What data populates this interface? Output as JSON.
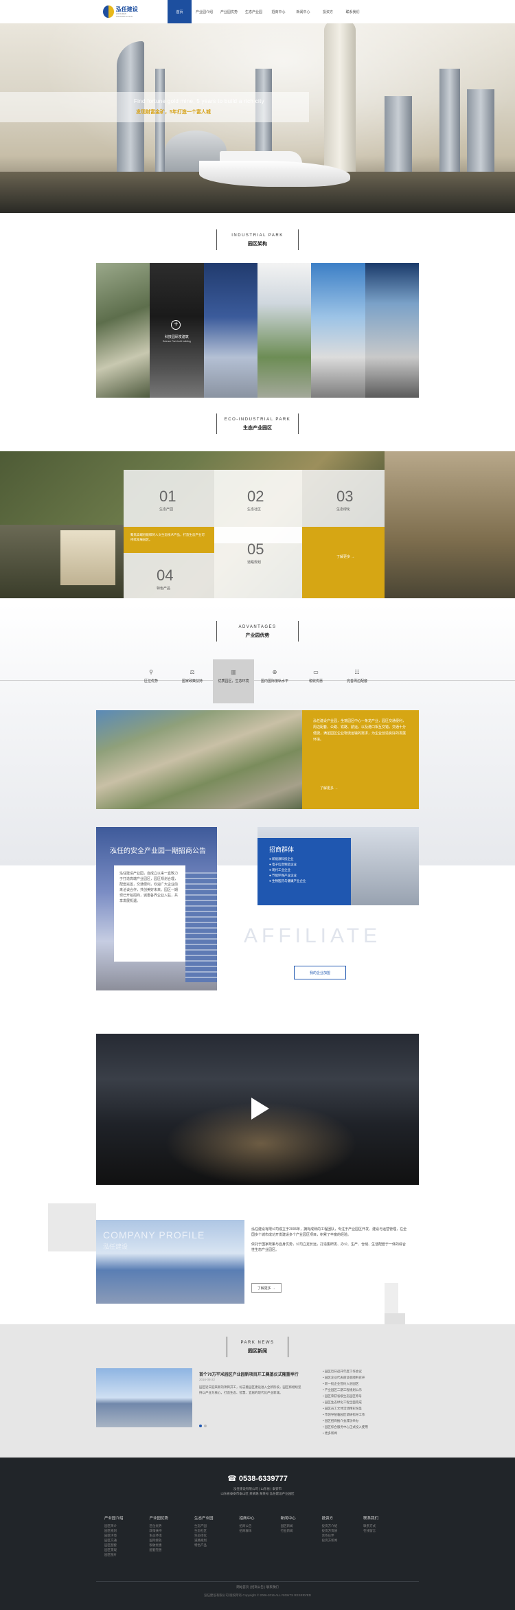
{
  "header": {
    "logo_text": "泓任建设",
    "logo_sub": "HONGREN CONSTRUCTION",
    "nav": [
      "首页",
      "产业园介绍",
      "产业园优势",
      "生态产业园",
      "招商中心",
      "新闻中心",
      "投资方",
      "联系我们"
    ]
  },
  "hero": {
    "en": "Find fortune gold mine, 5 years to build a rich city",
    "cn": "发现财富金矿，5年打造一个富人城"
  },
  "industrial": {
    "en": "INDUSTRIAL PARK",
    "cn": "园区架构",
    "feature_title": "科技园研发建筑",
    "feature_sub": "Science Park built building"
  },
  "eco": {
    "en": "ECO-INDUSTRIAL PARK",
    "cn": "生态产业园区",
    "cells": [
      {
        "num": "01",
        "label": "生态产园"
      },
      {
        "num": "02",
        "label": "生态社区"
      },
      {
        "num": "03",
        "label": "生态绿化"
      },
      {
        "num": "04",
        "label": "特色产品"
      },
      {
        "num": "05",
        "label": "道路规划"
      }
    ],
    "yellow_text": "聚焦高端低能碳的人文生态技术产品，打造生态产业可持续发展园区。",
    "more": "了解更多 →"
  },
  "advantages": {
    "en": "ADVANTAGES",
    "cn": "产业园优势",
    "tabs": [
      {
        "icon": "⚲",
        "label": "区位优势"
      },
      {
        "icon": "⚖",
        "label": "国家政策扶持"
      },
      {
        "icon": "▥",
        "label": "优质园区，生态环境"
      },
      {
        "icon": "⊕",
        "label": "国内国际接轨水平"
      },
      {
        "icon": "▭",
        "label": "税收优惠"
      },
      {
        "icon": "☷",
        "label": "完善周边配套"
      }
    ],
    "card_text": "泓任建设产业园，坐落园区中心一条龙产业，园区交通便利，周边配套，公路、铁路、航运，以及港口相互交错，交通十分便捷，满足园区企业物流运输的需求，为企业创造良好的发展环境。",
    "card_more": "了解更多 →"
  },
  "invest": {
    "left_title": "泓任的安全产业园一期招商公告",
    "left_text": "泓任建设产业园，自成立以来一直致力于打造高端产业园区，园区规划合理，配套完善，交通便利，欢迎广大企业前来洽谈合作，共创美好未来。园区一期现已开始招商，诚邀各界企业入驻，共享发展机遇。",
    "right_title": "招商群体",
    "right_list": [
      "● 新能源科技企业",
      "● 电子信息制造企业",
      "● 现代工业企业",
      "● 节能环保产业企业",
      "● 生物医药与健康产业企业"
    ],
    "affiliate": "AFFILIATE",
    "btn": "我的企业加盟"
  },
  "video": {
    "label": "play-video"
  },
  "profile": {
    "img_en": "COMPANY PROFILE",
    "img_cn": "泓任建设",
    "text1": "泓任建设有限公司成立于2006年，拥有成熟的工程团队，专注于产业园区开发、建设与运营管理，在全国多个城市成功开发建设多个产业园区项目，积累了丰富的经验。",
    "text2": "依托于国家政策与自身优势，公司立足长远，打造集研发、办公、生产、仓储、生活配套于一体的综合性生态产业园区。",
    "btn": "了解更多 →"
  },
  "news": {
    "en": "PARK NEWS",
    "cn": "园区新闻",
    "headline": "首个70万平米园区产业园新项目开工奠基仪式隆重举行",
    "date": "2016-08-22",
    "summary": "园区近日迎来新的项目开工，标志着园区建设进入全新阶段，园区将继续坚持以产业为核心，打造生态、智慧、宜居的现代化产业新城。",
    "list": [
      "• 园区近日召开年度工作会议",
      "• 园区企业代表座谈会顺利召开",
      "• 新一批企业签约入驻园区",
      "• 产业园区二期工程规划公示",
      "• 园区荣获省级生态园区称号",
      "• 园区生态绿化工程全面完成",
      "• 园区员工文体活动精彩纷呈",
      "• 市领导莅临园区调研指导工作",
      "• 园区招商推介会成功举办",
      "• 园区综合服务中心正式投入使用",
      "• 更多新闻"
    ]
  },
  "footer": {
    "phone": "0538-6339777",
    "info": [
      "泓任建设有限公司 | 山东省 | 泰安市",
      "山东省泰安市泰山区 某某路 某某号 泓任建设产业园区"
    ],
    "cols": [
      {
        "title": "产业园介绍",
        "items": [
          "园区简介",
          "园区规划",
          "园区环境",
          "园区交通",
          "园区配套",
          "园区景观",
          "园区图片"
        ]
      },
      {
        "title": "产业园优势",
        "items": [
          "区位优势",
          "政策扶持",
          "生态环境",
          "国际接轨",
          "税收优惠",
          "配套完善"
        ]
      },
      {
        "title": "生态产业园",
        "items": [
          "生态产园",
          "生态社区",
          "生态绿化",
          "道路规划",
          "特色产品"
        ]
      },
      {
        "title": "招商中心",
        "items": [
          "招商公告",
          "招商群体"
        ]
      },
      {
        "title": "新闻中心",
        "items": [
          "园区新闻",
          "行业新闻"
        ]
      },
      {
        "title": "投资方",
        "items": [
          "投资方介绍",
          "投资方资质",
          "合作伙伴",
          "投资方新闻"
        ]
      },
      {
        "title": "联系我们",
        "items": [
          "联系方式",
          "在线留言"
        ]
      }
    ],
    "links": "网站首页 | 招商公告 | 联系我们",
    "copy": "泓任建设有限公司 版权所有 Copyright © 2006-2016 ALL RIGHTS RESERVED"
  }
}
